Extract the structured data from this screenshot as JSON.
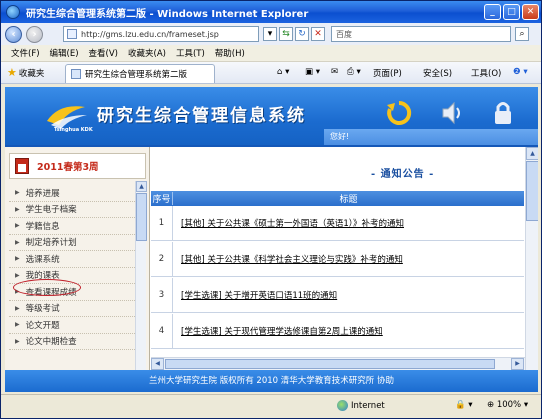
{
  "window": {
    "title": "研究生综合管理系统第二版 - Windows Internet Explorer",
    "minimize": "_",
    "maximize": "□",
    "close": "✕"
  },
  "address": {
    "url": "http://gms.lzu.edu.cn/frameset.jsp",
    "search_placeholder": "百度"
  },
  "menu": [
    "文件(F)",
    "编辑(E)",
    "查看(V)",
    "收藏夹(A)",
    "工具(T)",
    "帮助(H)"
  ],
  "favorites": {
    "label": "收藏夹",
    "tab_title": "研究生综合管理系统第二版",
    "tools": {
      "page": "页面(P)",
      "security": "安全(S)",
      "tools": "工具(O)"
    }
  },
  "banner": {
    "system_name": "研究生综合管理信息系统",
    "logo_text": "Tsinghua KDK",
    "welcome": "您好!"
  },
  "sidebar": {
    "semester": "2011春第3周",
    "items": [
      "培养进展",
      "学生电子档案",
      "学籍信息",
      "制定培养计划",
      "选课系统",
      "我的课表",
      "查看课程成绩",
      "等级考试",
      "论文开题",
      "论文中期检查"
    ]
  },
  "main": {
    "section_title": "- 通知公告 -",
    "columns": [
      "序号",
      "标题"
    ],
    "rows": [
      {
        "num": "1",
        "title": "[其他] 关于公共课《硕士第一外国语（英语1）》补考的通知"
      },
      {
        "num": "2",
        "title": "[其他] 关于公共课《科学社会主义理论与实践》补考的通知"
      },
      {
        "num": "3",
        "title": "[学生选课] 关于增开英语口语11班的通知"
      },
      {
        "num": "4",
        "title": "[学生选课] 关于现代管理学选修课自第2周上课的通知"
      }
    ]
  },
  "footer": {
    "text": "兰州大学研究生院 版权所有 2010 清华大学教育技术研究所 协助"
  },
  "status": {
    "zone": "Internet",
    "zoom": "100%"
  },
  "colors": {
    "banner_blue": "#1b6bcf",
    "title_bar": "#0b4fd0",
    "highlight_red": "#c0202a"
  }
}
